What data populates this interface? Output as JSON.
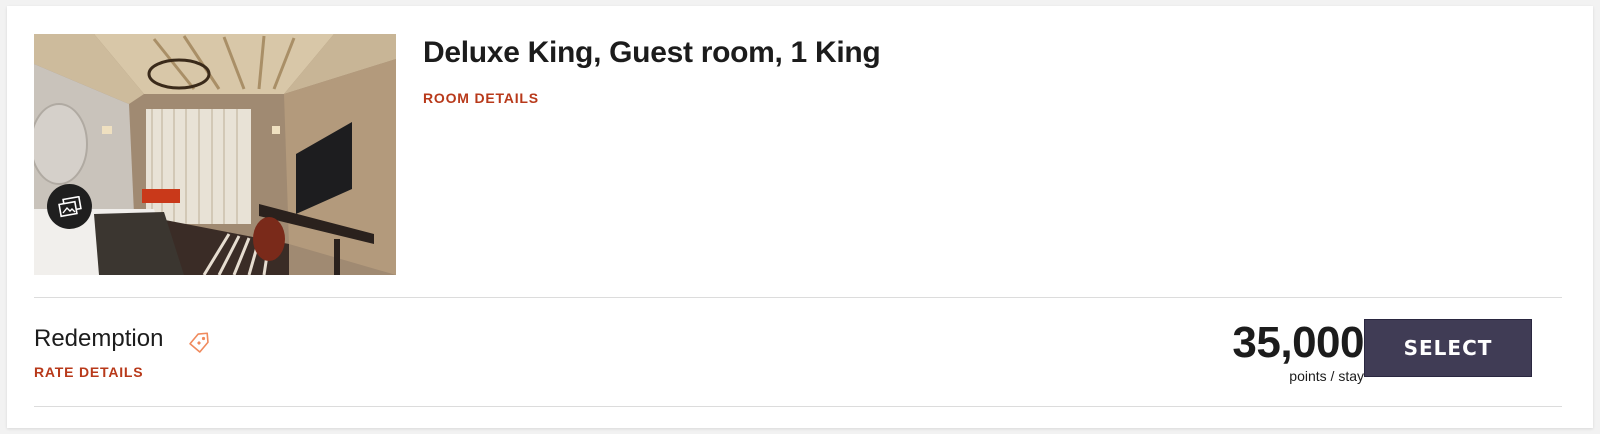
{
  "room": {
    "title": "Deluxe King, Guest room, 1 King",
    "details_link": "ROOM DETAILS",
    "image_icon": "gallery-icon"
  },
  "rate": {
    "name": "Redemption",
    "tag_icon": "price-tag-icon",
    "details_link": "RATE DETAILS",
    "price": "35,000",
    "price_unit": "points / stay",
    "select_label": "SELECT"
  },
  "colors": {
    "accent_link": "#b8391a",
    "button_bg": "#403c55",
    "tag_icon": "#f08a5d"
  }
}
